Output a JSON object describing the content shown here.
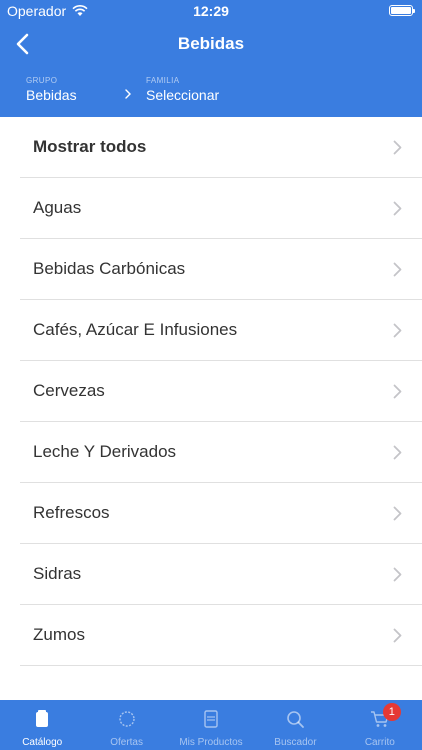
{
  "status_bar": {
    "carrier": "Operador",
    "time": "12:29"
  },
  "nav": {
    "title": "Bebidas"
  },
  "filters": {
    "group": {
      "label": "GRUPO",
      "value": "Bebidas"
    },
    "family": {
      "label": "FAMILIA",
      "value": "Seleccionar"
    }
  },
  "list": {
    "items": [
      {
        "label": "Mostrar todos"
      },
      {
        "label": "Aguas"
      },
      {
        "label": "Bebidas Carbónicas"
      },
      {
        "label": "Cafés, Azúcar E Infusiones"
      },
      {
        "label": "Cervezas"
      },
      {
        "label": "Leche Y Derivados"
      },
      {
        "label": "Refrescos"
      },
      {
        "label": "Sidras"
      },
      {
        "label": "Zumos"
      }
    ]
  },
  "tabbar": {
    "tabs": [
      {
        "label": "Catálogo",
        "icon": "catalog-icon",
        "active": true
      },
      {
        "label": "Ofertas",
        "icon": "offers-icon"
      },
      {
        "label": "Mis Productos",
        "icon": "products-icon"
      },
      {
        "label": "Buscador",
        "icon": "search-icon"
      },
      {
        "label": "Carrito",
        "icon": "cart-icon",
        "badge": "1"
      }
    ]
  },
  "colors": {
    "primary": "#3a7de0",
    "badge": "#e53935"
  }
}
